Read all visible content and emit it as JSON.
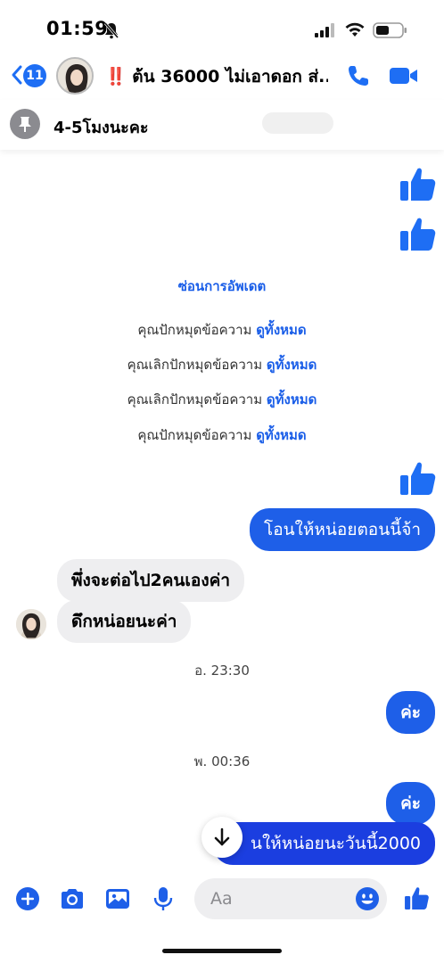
{
  "status_bar": {
    "time": "01:59"
  },
  "header": {
    "back_badge": "11",
    "title_prefix": "‼️",
    "title": "ต้น 36000 ไม่เอาดอก ส่...",
    "title_text": "ต้น 36000 ไม่เอาดอก ส่..."
  },
  "pinned": {
    "text": "4-5โมงนะคะ"
  },
  "chat": {
    "hide_updates": "ซ่อนการอัพเดต",
    "system_events": [
      {
        "text": "คุณปักหมุดข้อความ ",
        "link": "ดูทั้งหมด"
      },
      {
        "text": "คุณเลิกปักหมุดข้อความ ",
        "link": "ดูทั้งหมด"
      },
      {
        "text": "คุณเลิกปักหมุดข้อความ ",
        "link": "ดูทั้งหมด"
      },
      {
        "text": "คุณปักหมุดข้อความ ",
        "link": "ดูทั้งหมด"
      }
    ],
    "outgoing_1": "โอนให้หน่อยตอนนี้จ้า",
    "incoming_1": "พึ่งจะต่อไป2คนเองค่า",
    "incoming_2": "ดึกหน่อยนะค่า",
    "timestamp_1": "อ. 23:30",
    "outgoing_2": "ค่ะ",
    "timestamp_2": "พ. 00:36",
    "outgoing_3": "ค่ะ",
    "outgoing_4": "...นให้หน่อยนะวันนี้2000",
    "outgoing_4_visible": "นให้หน่อยนะวันนี้2000"
  },
  "composer": {
    "placeholder": "Aa"
  },
  "colors": {
    "accent": "#1e5fe8",
    "bubble_in": "#eeeef0",
    "alert": "#e0242b"
  },
  "icons": [
    "bell-off-icon",
    "signal-icon",
    "wifi-icon",
    "battery-icon",
    "back-chevron-icon",
    "phone-icon",
    "video-icon",
    "pin-icon",
    "thumbs-up-icon",
    "arrow-down-icon",
    "plus-icon",
    "camera-icon",
    "image-icon",
    "microphone-icon",
    "emoji-icon"
  ]
}
